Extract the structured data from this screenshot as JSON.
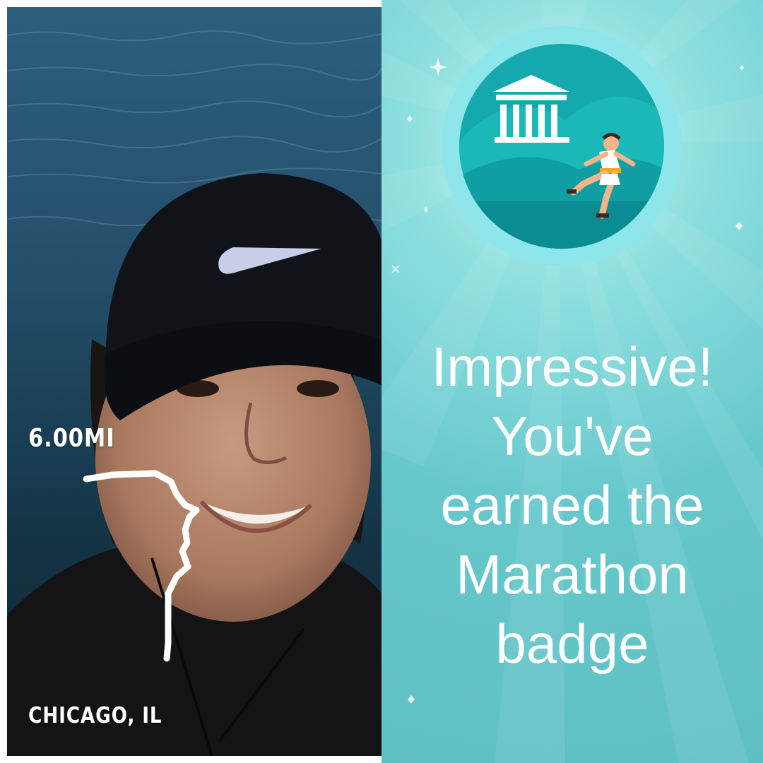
{
  "run": {
    "distance": "6.00MI",
    "location": "CHICAGO, IL"
  },
  "badge": {
    "name": "Marathon",
    "message_lines": [
      "Impressive!",
      "You've",
      "earned the",
      "Marathon",
      "badge"
    ]
  },
  "colors": {
    "badge_panel": "#67c8cc",
    "badge_ring": "#8fe6ea",
    "badge_disc": "#15a9ad",
    "text": "#ffffff"
  },
  "icons": [
    "temple-icon",
    "runner-icon"
  ]
}
